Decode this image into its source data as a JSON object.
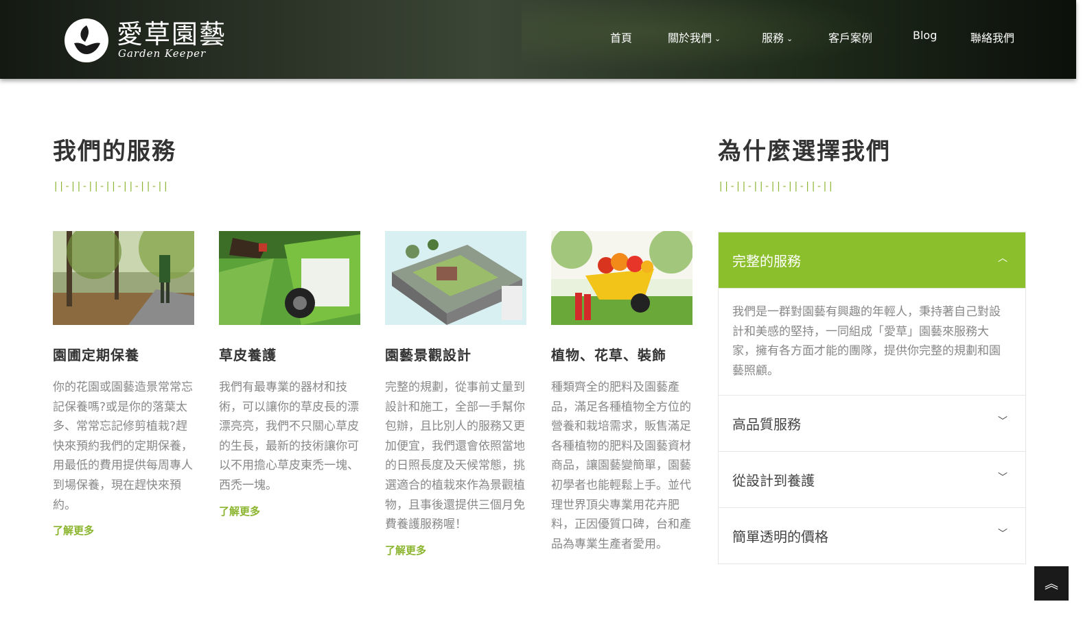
{
  "brand": {
    "name": "愛草園藝",
    "tagline": "Garden Keeper"
  },
  "nav": {
    "items": [
      {
        "label": "首頁"
      },
      {
        "label": "關於我們",
        "chevron": "⌄"
      },
      {
        "label": "服務",
        "chevron": "⌄"
      },
      {
        "label": "客戶案例"
      },
      {
        "label": "Blog"
      },
      {
        "label": "聯絡我們"
      }
    ]
  },
  "services": {
    "title": "我們的服務",
    "divider": "||-||-||-||-||-||-||",
    "cards": [
      {
        "title": "園圃定期保養",
        "desc": "你的花園或園藝造景常常忘記保養嗎?或是你的落葉太多、常常忘記修剪植栽?趕快來預約我們的定期保養，用最低的費用提供每周專人到場保養，現在趕快來預約。",
        "more": "了解更多"
      },
      {
        "title": "草皮養護",
        "desc": "我們有最專業的器材和技術，可以讓你的草皮長的漂漂亮亮，我們不只關心草皮的生長，最新的技術讓你可以不用擔心草皮東禿一塊、西禿一塊。",
        "more": "了解更多"
      },
      {
        "title": "園藝景觀設計",
        "desc": "完整的規劃，從事前丈量到設計和施工，全部一手幫你包辦，且比別人的服務又更加便宜，我們還會依照當地的日照長度及天候常態，挑選適合的植栽來作為景觀植物，且事後還提供三個月免費養護服務喔！",
        "more": "了解更多"
      },
      {
        "title": "植物、花草、裝飾",
        "desc": "種類齊全的肥料及園藝產品，滿足各種植物全方位的營養和栽培需求，販售滿足各種植物的肥料及園藝資材商品，讓園藝變簡單，園藝初學者也能輕鬆上手。並代理世界頂尖專業用花卉肥料，正因優質口碑，台和產品為專業生產者愛用。",
        "more": ""
      }
    ]
  },
  "why": {
    "title": "為什麼選擇我們",
    "divider": "||-||-||-||-||-||-||",
    "items": [
      {
        "label": "完整的服務",
        "body": "我們是一群對園藝有興趣的年輕人，秉持著自己對設計和美感的堅持，一同組成「愛草」園藝來服務大家，擁有各方面才能的團隊，提供你完整的規劃和園藝照顧。",
        "chevron": "︿"
      },
      {
        "label": "高品質服務",
        "chevron": "﹀"
      },
      {
        "label": "從設計到養護",
        "chevron": "﹀"
      },
      {
        "label": "簡單透明的價格",
        "chevron": "﹀"
      }
    ]
  },
  "back_to_top": {
    "icon": "double-chevron-up-icon",
    "glyph": "︽"
  },
  "colors": {
    "accent": "#8bbf2c",
    "header_bg": "#1e2a1a",
    "text": "#333333",
    "muted": "#888888"
  }
}
